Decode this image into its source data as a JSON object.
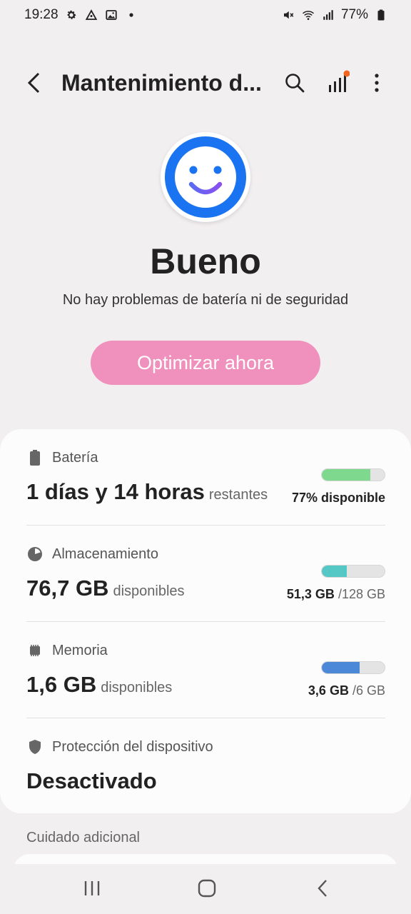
{
  "status_bar": {
    "time": "19:28",
    "icons_left": [
      "gear-icon",
      "triangle-app-icon",
      "image-icon",
      "dot-icon"
    ],
    "icons_right": [
      "mute-icon",
      "wifi-icon",
      "signal-icon",
      "battery-icon"
    ],
    "battery": "77%"
  },
  "app_bar": {
    "title": "Mantenimiento d...",
    "notification_dot_color": "#f0651f"
  },
  "hero": {
    "status": "Bueno",
    "subtitle": "No hay problemas de batería ni de seguridad",
    "optimize_label": "Optimizar ahora",
    "face_ring_color": "#1a73f0",
    "button_color": "#f090bc"
  },
  "battery": {
    "title": "Batería",
    "value": "1 días y 14 horas",
    "unit": "restantes",
    "available": "77% disponible",
    "level": 0.77,
    "color": "#7ed98f"
  },
  "storage": {
    "title": "Almacenamiento",
    "value": "76,7 GB",
    "unit": "disponibles",
    "used": "51,3 GB",
    "total": "/128 GB",
    "level": 0.4,
    "color": "#55c7c4"
  },
  "memory": {
    "title": "Memoria",
    "value": "1,6 GB",
    "unit": "disponibles",
    "used": "3,6 GB",
    "total": "/6 GB",
    "level": 0.6,
    "color": "#4b88d8"
  },
  "protection": {
    "title": "Protección del dispositivo",
    "value": "Desactivado"
  },
  "extra": {
    "label": "Cuidado adicional"
  }
}
